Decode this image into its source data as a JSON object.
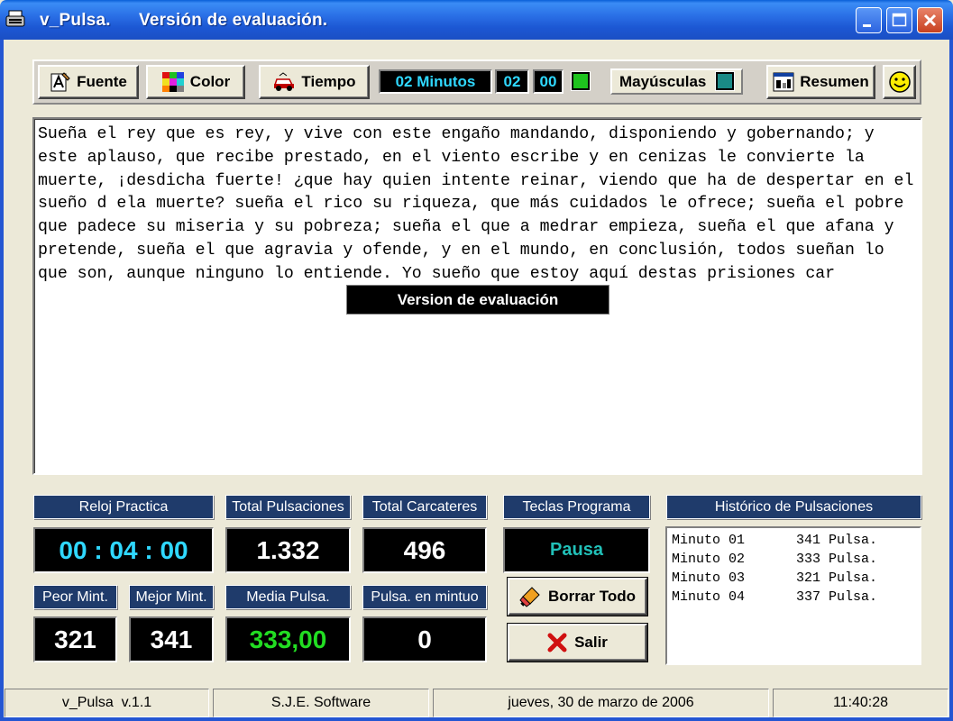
{
  "window": {
    "app_name": "v_Pulsa.",
    "subtitle": "Versión de evaluación."
  },
  "toolbar": {
    "font_label": "Fuente",
    "color_label": "Color",
    "time_label": "Tiempo",
    "minutes_display": "02 Minutos",
    "minutes_value": "02",
    "seconds_value": "00",
    "caps_label": "Mayúsculas",
    "summary_label": "Resumen"
  },
  "editor": {
    "text": "Sueña el rey que es rey, y vive con este engaño mandando, disponiendo y gobernando; y este aplauso, que recibe prestado, en el viento escribe y en cenizas le convierte la muerte, ¡desdicha fuerte! ¿que hay quien intente reinar, viendo que ha de despertar en el sueño d ela muerte? sueña el rico su riqueza, que más cuidados le ofrece; sueña el pobre que padece su miseria y su pobreza; sueña el que a medrar empieza, sueña el que afana y pretende, sueña el que agravia y ofende, y en el mundo, en conclusión, todos sueñan lo que son, aunque ninguno lo entiende. Yo sueño que estoy aquí destas prisiones car",
    "eval_banner": "Version de evaluación"
  },
  "stats": {
    "practice_clock_label": "Reloj Practica",
    "practice_clock_value": "00 : 04 : 00",
    "total_keystrokes_label": "Total Pulsaciones",
    "total_keystrokes_value": "1.332",
    "total_chars_label": "Total Carcateres",
    "total_chars_value": "496",
    "program_keys_label": "Teclas Programa",
    "pause_label": "Pausa",
    "worst_min_label": "Peor Mint.",
    "worst_min_value": "321",
    "best_min_label": "Mejor Mint.",
    "best_min_value": "341",
    "average_label": "Media Pulsa.",
    "average_value": "333,00",
    "per_minute_label": "Pulsa. en mintuo",
    "per_minute_value": "0",
    "clear_all_label": "Borrar Todo",
    "exit_label": "Salir"
  },
  "history": {
    "title": "Histórico de Pulsaciones",
    "rows": [
      {
        "minute": "Minuto 01",
        "count": "341 Pulsa."
      },
      {
        "minute": "Minuto 02",
        "count": "333 Pulsa."
      },
      {
        "minute": "Minuto 03",
        "count": "321 Pulsa."
      },
      {
        "minute": "Minuto 04",
        "count": "337 Pulsa."
      }
    ]
  },
  "statusbar": {
    "version": "v_Pulsa  v.1.1",
    "company": "S.J.E. Software",
    "date": "jueves, 30 de marzo de 2006",
    "time": "11:40:28"
  },
  "colors": {
    "title_blue": "#2a6fe6",
    "lcd_cyan": "#2fd8ff",
    "lcd_green": "#22dd22",
    "header_navy": "#1f3b6b"
  }
}
